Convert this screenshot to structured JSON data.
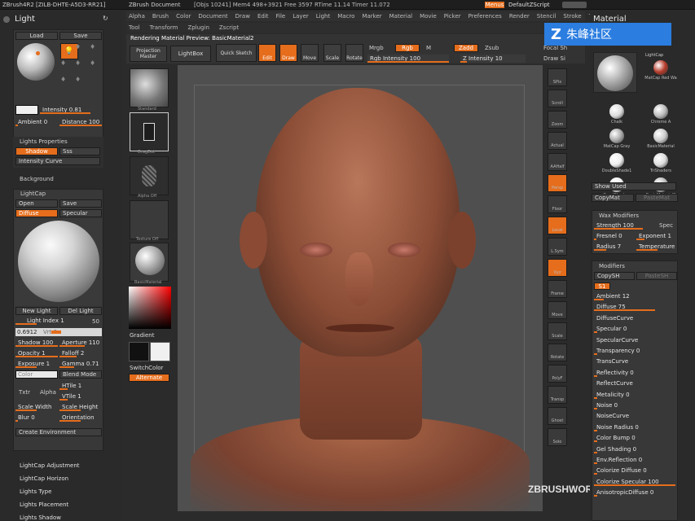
{
  "titlebar": {
    "app": "ZBrush4R2 [ZILB-DHTE-A5D3-RR21]",
    "doc": "ZBrush Document",
    "stats": "[Objs 10241]  Mem4 498+3921  Free 3597  RTime 11.14  Timer 11.072",
    "menus_btn": "Menus",
    "script_btn": "DefaultZScript"
  },
  "menubar": {
    "items": [
      "Alpha",
      "Brush",
      "Color",
      "Document",
      "Draw",
      "Edit",
      "File",
      "Layer",
      "Light",
      "Macro",
      "Marker",
      "Material",
      "Movie",
      "Picker",
      "Preferences",
      "Render",
      "Stencil",
      "Stroke",
      "Texture"
    ],
    "sub": [
      "Tool",
      "Transform",
      "Zplugin",
      "Zscript"
    ]
  },
  "toolbar": {
    "status": "Rendering Material Preview: BasicMaterial2",
    "projection_master": "Projection Master",
    "lightbox": "LightBox",
    "quick_sketch": "Quick Sketch",
    "edit": "Edit",
    "draw": "Draw",
    "move": "Move",
    "scale": "Scale",
    "rotate": "Rotate",
    "mrgb": "Mrgb",
    "rgb": "Rgb",
    "m": "M",
    "rgb_intensity": "Rgb Intensity 100",
    "zadd": "Zadd",
    "zsub": "Zsub",
    "z_intensity": "Z Intensity 10",
    "focal": "Focal Sh",
    "draw_size": "Draw Si"
  },
  "light": {
    "title": "Light",
    "load": "Load",
    "save": "Save",
    "intensity": "Intensity 0.81",
    "ambient": "Ambient 0",
    "distance": "Distance 100",
    "lights_properties": "Lights Properties",
    "shadow": "Shadow",
    "sss": "Sss",
    "intensity_curve": "Intensity Curve",
    "background": "Background",
    "lightcap": "LightCap",
    "open": "Open",
    "save2": "Save",
    "diffuse": "Diffuse",
    "specular": "Specular",
    "new_light": "New Light",
    "del_light": "Del Light",
    "light_index": "Light Index 1",
    "light_index_max": "50",
    "hrz": "0.6912",
    "vrt": "Vrt 0",
    "shadow_v": "Shadow 100",
    "aperture": "Aperture 110",
    "opacity": "Opacity 1",
    "falloff": "Falloff 2",
    "exposure": "Exposure 1",
    "gamma": "Gamma 0.71",
    "color": "Color",
    "blend_mode": "Blend Mode",
    "txtr": "Txtr",
    "alpha": "Alpha",
    "htile": "HTile 1",
    "vtile": "VTile 1",
    "scale_width": "Scale Width",
    "scale_height": "Scale Height",
    "blur": "Blur 0",
    "orientation": "Orientation",
    "create_env": "Create Environment",
    "sections": [
      "LightCap Adjustment",
      "LightCap Horizon",
      "Lights Type",
      "Lights Placement",
      "Lights Shadow"
    ]
  },
  "shelf": {
    "items": [
      "Standard",
      "DragDot",
      "Alpha Off",
      "Texture Off",
      "BasicMaterial"
    ],
    "gradient": "Gradient",
    "switchcolor": "SwitchColor",
    "alternate": "Alternate"
  },
  "righttools": [
    "SPix",
    "Scroll",
    "Zoom",
    "Actual",
    "AAHalf",
    "Persp",
    "Floor",
    "Local",
    "L.Sym",
    "Xyz",
    "Frame",
    "Move",
    "Scale",
    "Rotate",
    "PolyF",
    "Transp",
    "Ghost",
    "Solo"
  ],
  "material": {
    "title": "Material",
    "watermark": "朱峰社区",
    "lightcap_label": "LightCap",
    "items": [
      "MatCap Red Wa",
      "Chalk",
      "Chrome A",
      "MatCap Gray",
      "BasicMaterial",
      "DoubleShade1",
      "TriShaders",
      "QuadShaders",
      "BasicMaterial2"
    ],
    "show_used": "Show Used",
    "copymat": "CopyMat",
    "pastemat": "PasteMat",
    "wax_modifiers": "Wax Modifiers",
    "strength": "Strength 100",
    "spec": "Spec",
    "fresnel": "Fresnel 0",
    "exponent": "Exponent 1",
    "radius": "Radius 7",
    "temperature": "Temperature",
    "modifiers": "Modifiers",
    "copysh": "CopySH",
    "pastesh": "PasteSH",
    "s1": "S1",
    "params": [
      "Ambient 12",
      "Diffuse 75",
      "DiffuseCurve",
      "Specular 0",
      "SpecularCurve",
      "Transparency 0",
      "TransCurve",
      "Reflectivity 0",
      "ReflectCurve",
      "Metalicity 0",
      "Noise 0",
      "NoiseCurve",
      "Noise Radius 0",
      "Color Bump 0",
      "Gel Shading 0",
      "Env.Reflection 0",
      "Colorize Diffuse 0",
      "Colorize Specular 100",
      "AnisotropicDiffuse 0"
    ],
    "ref_brand": "ZBRUSHWORKSHOPS"
  },
  "colors": {
    "accent": "#e56d1c",
    "panel": "#2a2a2a",
    "canvas": "#4a4a4a"
  }
}
